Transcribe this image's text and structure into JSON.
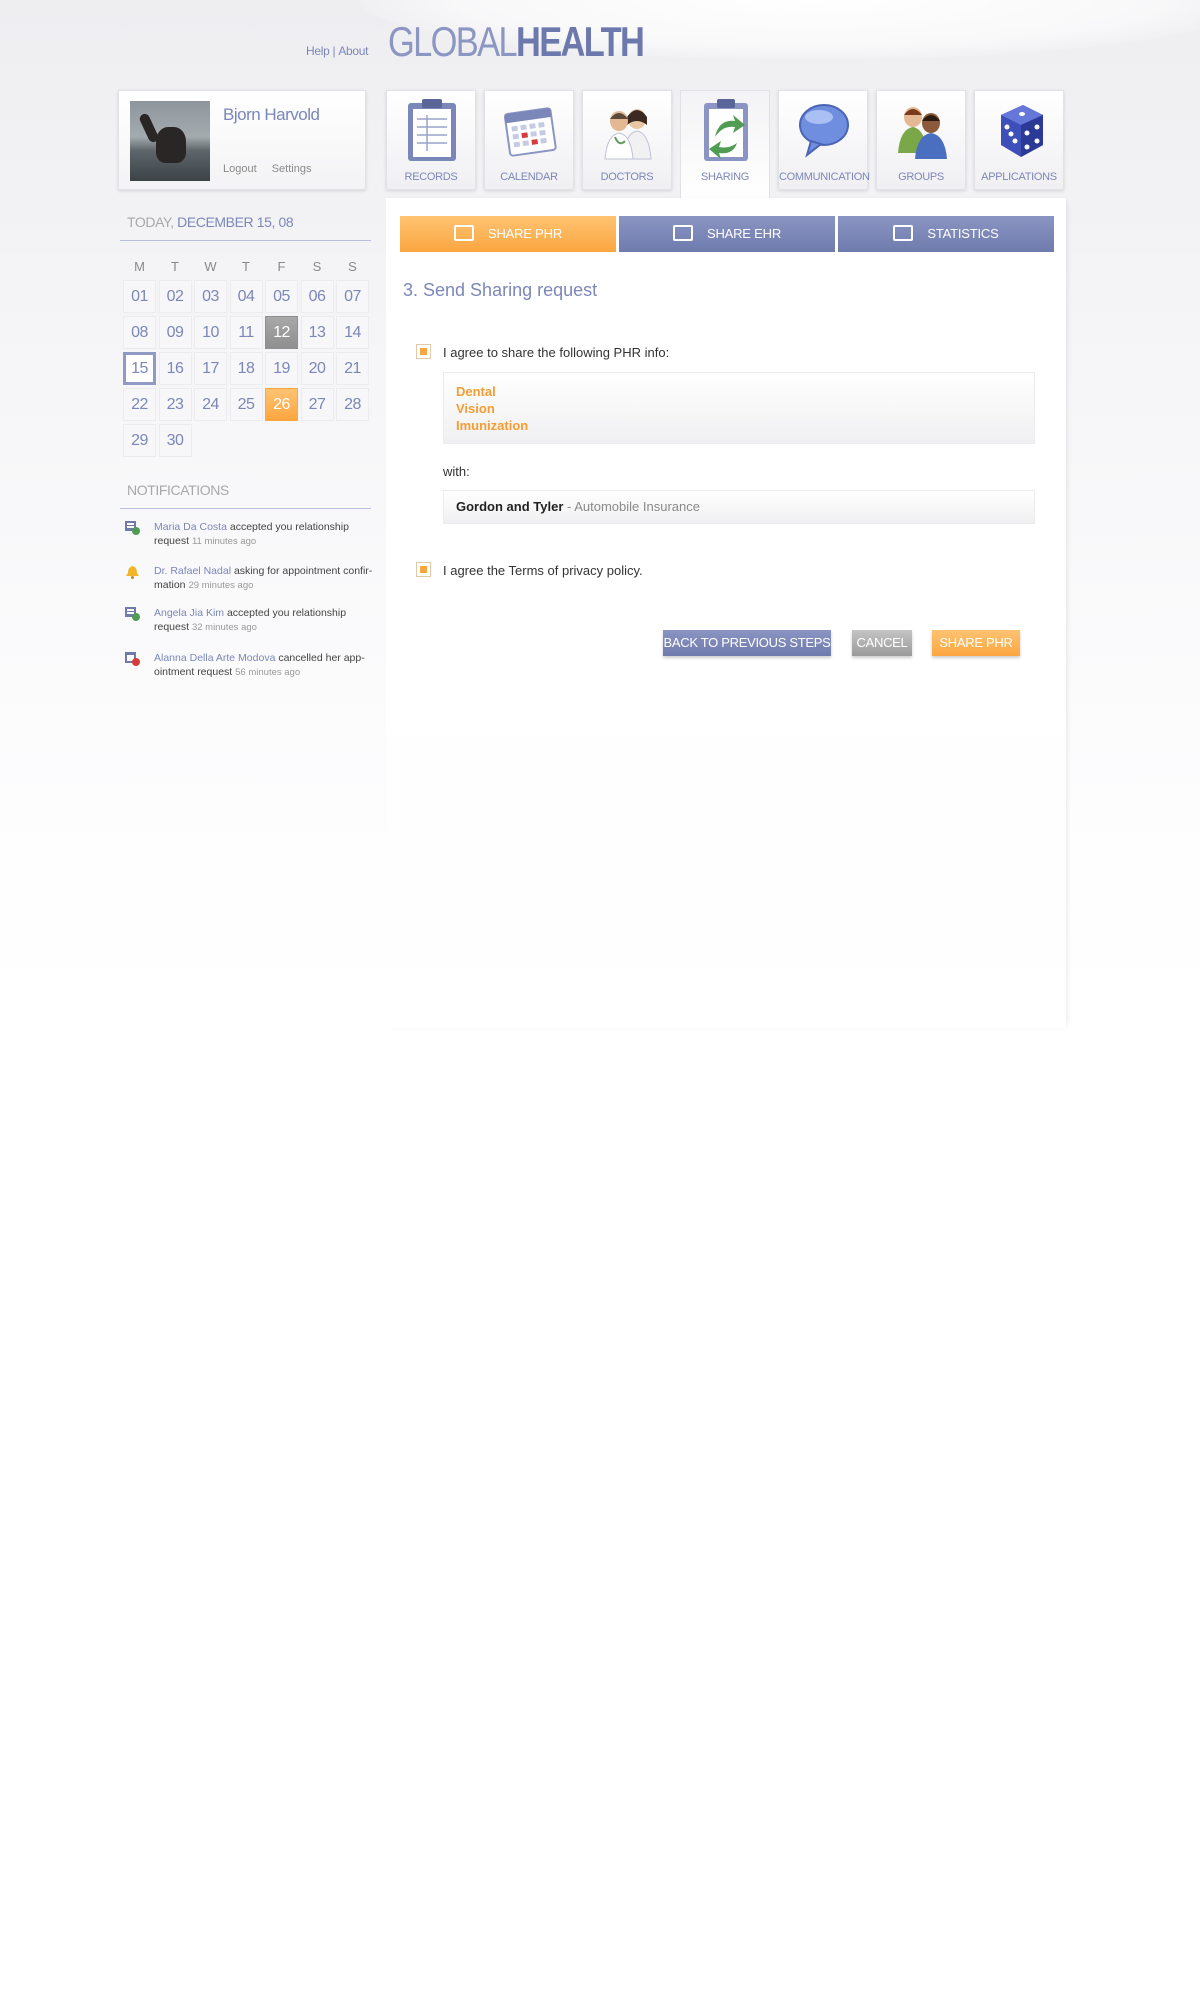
{
  "header": {
    "help_label": "Help",
    "separator": "|",
    "about_label": "About",
    "logo_light": "GLOBAL",
    "logo_bold": "HEALTH"
  },
  "profile": {
    "name": "Bjorn Harvold",
    "logout_label": "Logout",
    "settings_label": "Settings"
  },
  "app_tabs": [
    {
      "label": "RECORDS",
      "icon": "clipboard-records-icon"
    },
    {
      "label": "CALENDAR",
      "icon": "calendar-icon"
    },
    {
      "label": "DOCTORS",
      "icon": "doctors-icon"
    },
    {
      "label": "SHARING",
      "icon": "sharing-clipboard-icon",
      "active": true
    },
    {
      "label": "COMMUNICATION",
      "icon": "speech-bubble-icon"
    },
    {
      "label": "GROUPS",
      "icon": "group-people-icon"
    },
    {
      "label": "APPLICATIONS",
      "icon": "dice-icon"
    }
  ],
  "sub_tabs": [
    {
      "label": "SHARE PHR",
      "active": true
    },
    {
      "label": "SHARE EHR"
    },
    {
      "label": "STATISTICS"
    }
  ],
  "calendar": {
    "today_label": "TODAY,",
    "today_date": "DECEMBER 15, 08",
    "weekdays": [
      "M",
      "T",
      "W",
      "T",
      "F",
      "S",
      "S"
    ],
    "days": [
      "01",
      "02",
      "03",
      "04",
      "05",
      "06",
      "07",
      "08",
      "09",
      "10",
      "11",
      "12",
      "13",
      "14",
      "15",
      "16",
      "17",
      "18",
      "19",
      "20",
      "21",
      "22",
      "23",
      "24",
      "25",
      "26",
      "27",
      "28",
      "29",
      "30"
    ],
    "highlight_grey": "12",
    "highlight_orange": "26",
    "today_day": "15"
  },
  "notifications": {
    "title": "NOTIFICATIONS",
    "items": [
      {
        "who": "Maria Da Costa",
        "text": " accepted you relationship request ",
        "ago": "11 minutes ago",
        "icon": "relationship-accepted-icon"
      },
      {
        "who": "Dr. Rafael Nadal",
        "text": " asking for appointment confir-mation ",
        "ago": "29 minutes ago",
        "icon": "bell-icon"
      },
      {
        "who": "Angela Jia Kim",
        "text": " accepted you relationship request ",
        "ago": "32 minutes ago",
        "icon": "relationship-accepted-icon"
      },
      {
        "who": "Alanna Della Arte Modova",
        "text": " cancelled her app-ointment request ",
        "ago": "56 minutes ago",
        "icon": "appointment-cancelled-icon"
      }
    ]
  },
  "main": {
    "step_title": "3. Send Sharing request",
    "agree_share_label": "I agree to share the following PHR info:",
    "phr_items": [
      "Dental",
      "Vision",
      "Imunization"
    ],
    "with_label": "with:",
    "recipient_name": "Gordon and Tyler",
    "recipient_org": " - Automobile Insurance",
    "agree_terms_label": "I agree the Terms of privacy policy.",
    "back_button": "BACK TO PREVIOUS STEPS",
    "cancel_button": "CANCEL",
    "share_button": "SHARE PHR"
  },
  "colors": {
    "accent_blue": "#7b87b8",
    "accent_orange": "#fba640"
  }
}
